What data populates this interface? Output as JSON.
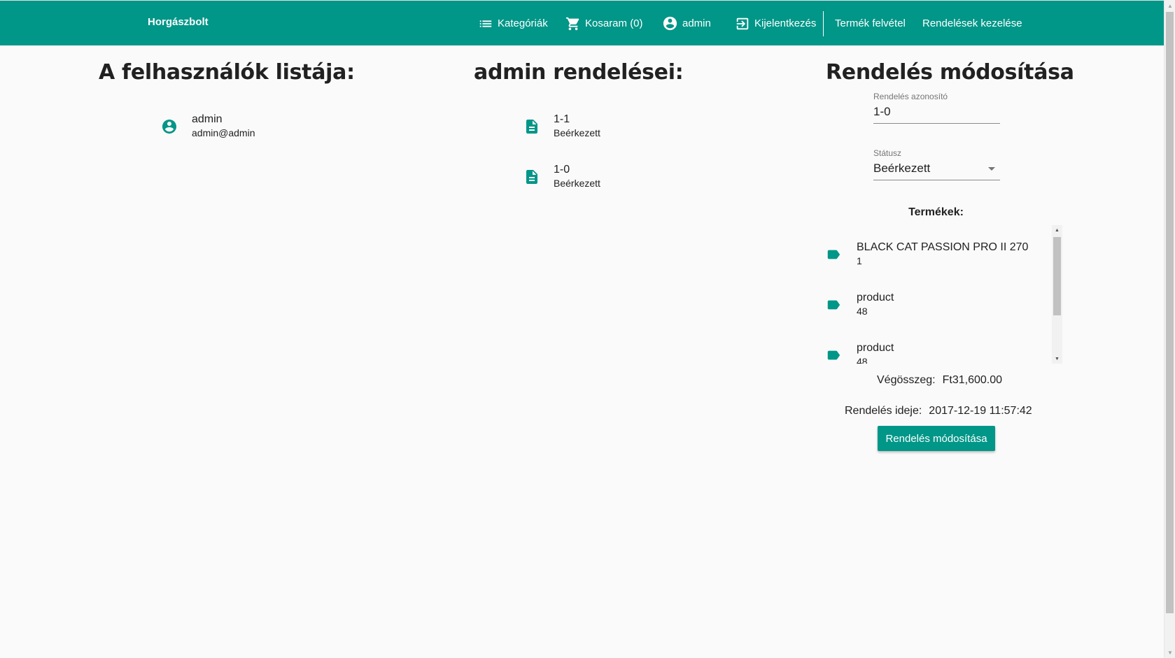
{
  "toolbar": {
    "brand": "Horgászbolt",
    "categories": "Kategóriák",
    "cart": "Kosaram (0)",
    "user": "admin",
    "logout": "Kijelentkezés",
    "add_product": "Termék felvétel",
    "manage_orders": "Rendelések kezelése"
  },
  "users": {
    "title": "A felhasználók listája:",
    "items": [
      {
        "name": "admin",
        "email": "admin@admin",
        "icon": "account-circle-icon"
      }
    ]
  },
  "orders": {
    "title": "admin rendelései:",
    "items": [
      {
        "id": "1-1",
        "status": "Beérkezett",
        "icon": "description-icon"
      },
      {
        "id": "1-0",
        "status": "Beérkezett",
        "icon": "description-icon"
      }
    ]
  },
  "edit": {
    "title": "Rendelés módosítása",
    "order_id_label": "Rendelés azonosító",
    "order_id_value": "1-0",
    "status_label": "Státusz",
    "status_value": "Beérkezett",
    "products_title": "Termékek:",
    "products": [
      {
        "name": "BLACK CAT PASSION PRO II 270",
        "qty": "1",
        "icon": "label-icon"
      },
      {
        "name": "product",
        "qty": "48",
        "icon": "label-icon"
      },
      {
        "name": "product",
        "qty": "48",
        "icon": "label-icon"
      }
    ],
    "total_label": "Végösszeg:",
    "total_value": "Ft31,600.00",
    "date_label": "Rendelés ideje:",
    "date_value": "2017-12-19 11:57:42",
    "submit_label": "Rendelés módosítása"
  },
  "colors": {
    "primary": "#009688",
    "background": "#fafafa",
    "text": "#212121"
  }
}
